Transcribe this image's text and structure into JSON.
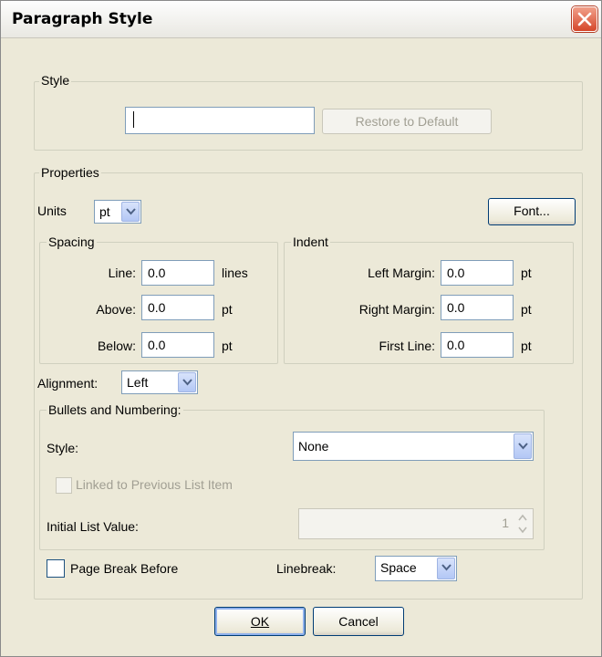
{
  "window": {
    "title": "Paragraph Style"
  },
  "style_group": {
    "legend": "Style",
    "name_value": "",
    "restore_label": "Restore to Default"
  },
  "properties": {
    "legend": "Properties",
    "units_label": "Units",
    "units_value": "pt",
    "font_button": "Font...",
    "spacing": {
      "legend": "Spacing",
      "line_label": "Line:",
      "line_value": "0.0",
      "line_unit": "lines",
      "above_label": "Above:",
      "above_value": "0.0",
      "above_unit": "pt",
      "below_label": "Below:",
      "below_value": "0.0",
      "below_unit": "pt"
    },
    "indent": {
      "legend": "Indent",
      "left_label": "Left Margin:",
      "left_value": "0.0",
      "left_unit": "pt",
      "right_label": "Right Margin:",
      "right_value": "0.0",
      "right_unit": "pt",
      "first_label": "First Line:",
      "first_value": "0.0",
      "first_unit": "pt"
    },
    "alignment_label": "Alignment:",
    "alignment_value": "Left",
    "bullets": {
      "legend": "Bullets and Numbering:",
      "style_label": "Style:",
      "style_value": "None",
      "linked_label": "Linked to Previous List Item",
      "initial_label": "Initial List Value:",
      "initial_value": "1"
    },
    "page_break_label": "Page Break Before",
    "linebreak_label": "Linebreak:",
    "linebreak_value": "Space"
  },
  "buttons": {
    "ok": "OK",
    "cancel": "Cancel"
  },
  "icons": {
    "close": "close-icon",
    "dropdown": "chevron-down-icon",
    "spin": "spin-arrows-icon"
  }
}
